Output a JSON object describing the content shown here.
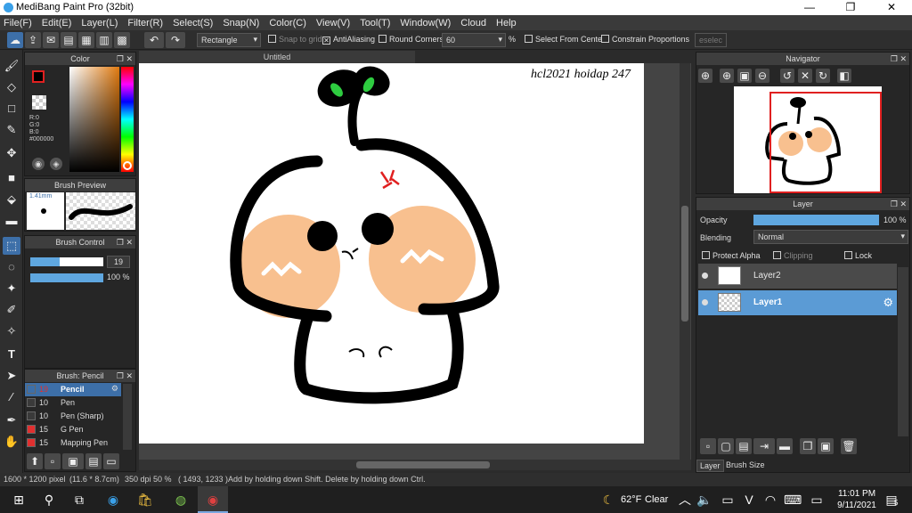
{
  "window": {
    "title": "MediBang Paint Pro (32bit)",
    "minimize": "—",
    "maximize": "❐",
    "close": "✕"
  },
  "menu": [
    "File(F)",
    "Edit(E)",
    "Layer(L)",
    "Filter(R)",
    "Select(S)",
    "Snap(N)",
    "Color(C)",
    "View(V)",
    "Tool(T)",
    "Window(W)",
    "Cloud",
    "Help"
  ],
  "options": {
    "shape": "Rectangle",
    "snap_to_grid": "Snap to grid",
    "antialiasing": "AntiAliasing",
    "round_corners": "Round Corners",
    "round_value": "60",
    "percent": "%",
    "select_from_center": "Select From Center",
    "constrain": "Constrain Proportions",
    "deselect": "eselec"
  },
  "color_panel": {
    "title": "Color",
    "r": "R:0",
    "g": "G:0",
    "b": "B:0",
    "hex": "#000000",
    "fg": "#000000",
    "bg": "#ffffff",
    "accent": "#e02020"
  },
  "brush_preview": {
    "title": "Brush Preview",
    "size": "1.41mm"
  },
  "brush_control": {
    "title": "Brush Control",
    "size": "19",
    "opacity": "100 %",
    "size_level": 0.4,
    "opacity_level": 1.0
  },
  "brush_list": {
    "title": "Brush: Pencil",
    "items": [
      {
        "size": "19",
        "name": "Pencil",
        "color": "#3d6fa8"
      },
      {
        "size": "10",
        "name": "Pen",
        "color": "#3a3a3a"
      },
      {
        "size": "10",
        "name": "Pen (Sharp)",
        "color": "#3a3a3a"
      },
      {
        "size": "15",
        "name": "G Pen",
        "color": "#e03030"
      },
      {
        "size": "15",
        "name": "Mapping Pen",
        "color": "#e03030"
      }
    ]
  },
  "document": {
    "tab": "Untitled"
  },
  "signature": "hcl2021 hoidap 247",
  "navigator": {
    "title": "Navigator"
  },
  "layer_panel": {
    "title": "Layer",
    "opacity_label": "Opacity",
    "opacity_value": "100 %",
    "opacity_level": 1.0,
    "blending_label": "Blending",
    "blending_value": "Normal",
    "protect_alpha": "Protect Alpha",
    "clipping": "Clipping",
    "lock": "Lock",
    "layers": [
      {
        "name": "Layer2",
        "selected": false
      },
      {
        "name": "Layer1",
        "selected": true
      }
    ],
    "tabs": [
      "Layer",
      "Brush Size"
    ]
  },
  "status": {
    "size": "1600 * 1200 pixel",
    "cm": "(11.6 * 8.7cm)",
    "dpi": "350 dpi",
    "zoom": "50 %",
    "coords": "( 1493, 1233 )",
    "hint": "Add by holding down Shift. Delete by holding down Ctrl."
  },
  "taskbar": {
    "weather_temp": "62°F",
    "weather_text": "Clear",
    "time": "11:01 PM",
    "date": "9/11/2021",
    "notif_count": "5"
  }
}
